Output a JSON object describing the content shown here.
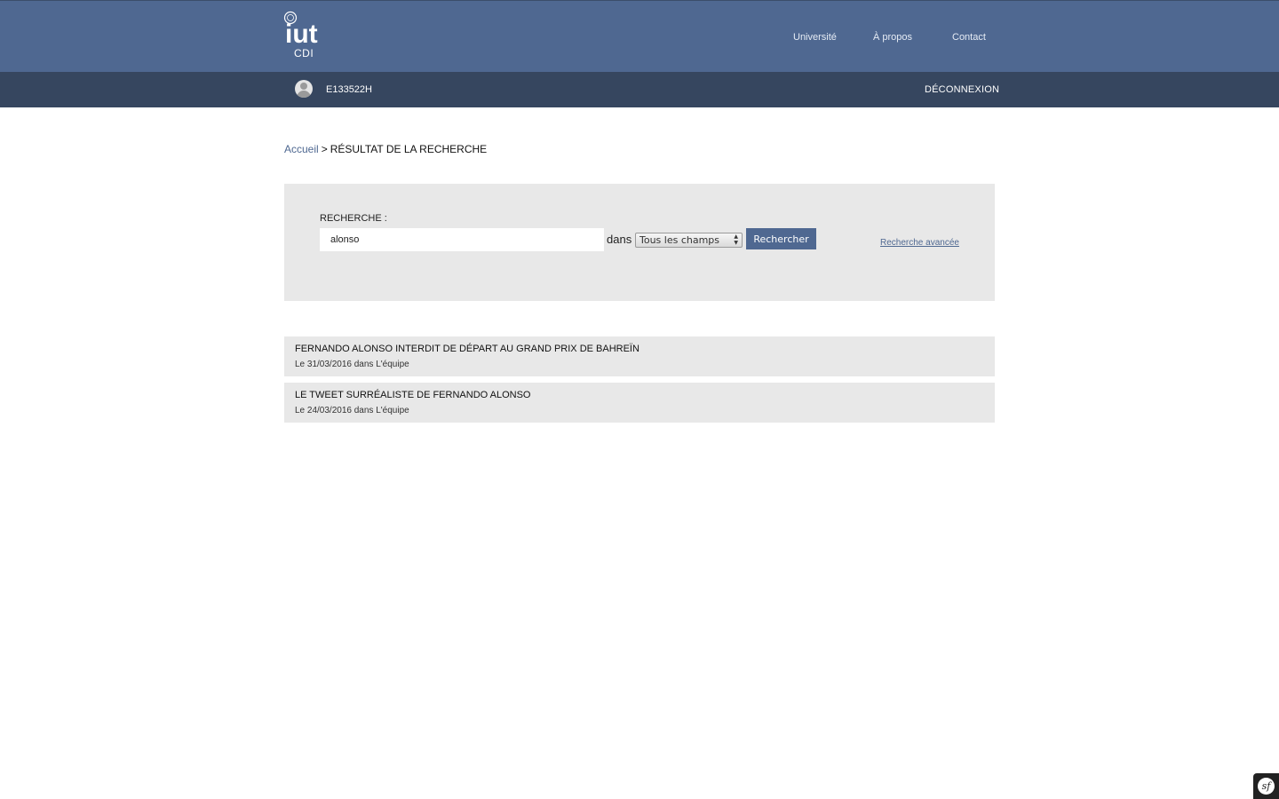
{
  "header": {
    "logo_text": "iut",
    "logo_subtitle": "CDI",
    "nav": [
      {
        "label": "Université"
      },
      {
        "label": "À propos"
      },
      {
        "label": "Contact"
      }
    ]
  },
  "userbar": {
    "username": "E133522H",
    "logout_label": "DÉCONNEXION"
  },
  "breadcrumb": {
    "home": "Accueil",
    "separator": ">",
    "current": "RÉSULTAT DE LA RECHERCHE"
  },
  "search": {
    "label": "RECHERCHE :",
    "query": "alonso",
    "in_label": "dans",
    "field_selected": "Tous les champs",
    "submit_label": "Rechercher",
    "advanced_label": "Recherche avancée"
  },
  "results": [
    {
      "title": "FERNANDO ALONSO INTERDIT DE DÉPART AU GRAND PRIX DE BAHREÏN",
      "meta": "Le 31/03/2016 dans L'équipe"
    },
    {
      "title": "LE TWEET SURRÉALISTE DE FERNANDO ALONSO",
      "meta": "Le 24/03/2016 dans L'équipe"
    }
  ],
  "debug_toolbar": {
    "icon": "symfony-icon",
    "glyph": "sf"
  },
  "colors": {
    "header_bg": "#4f6891",
    "userbar_bg": "#36465f",
    "panel_bg": "#e8e8e8",
    "accent": "#4f6891"
  }
}
